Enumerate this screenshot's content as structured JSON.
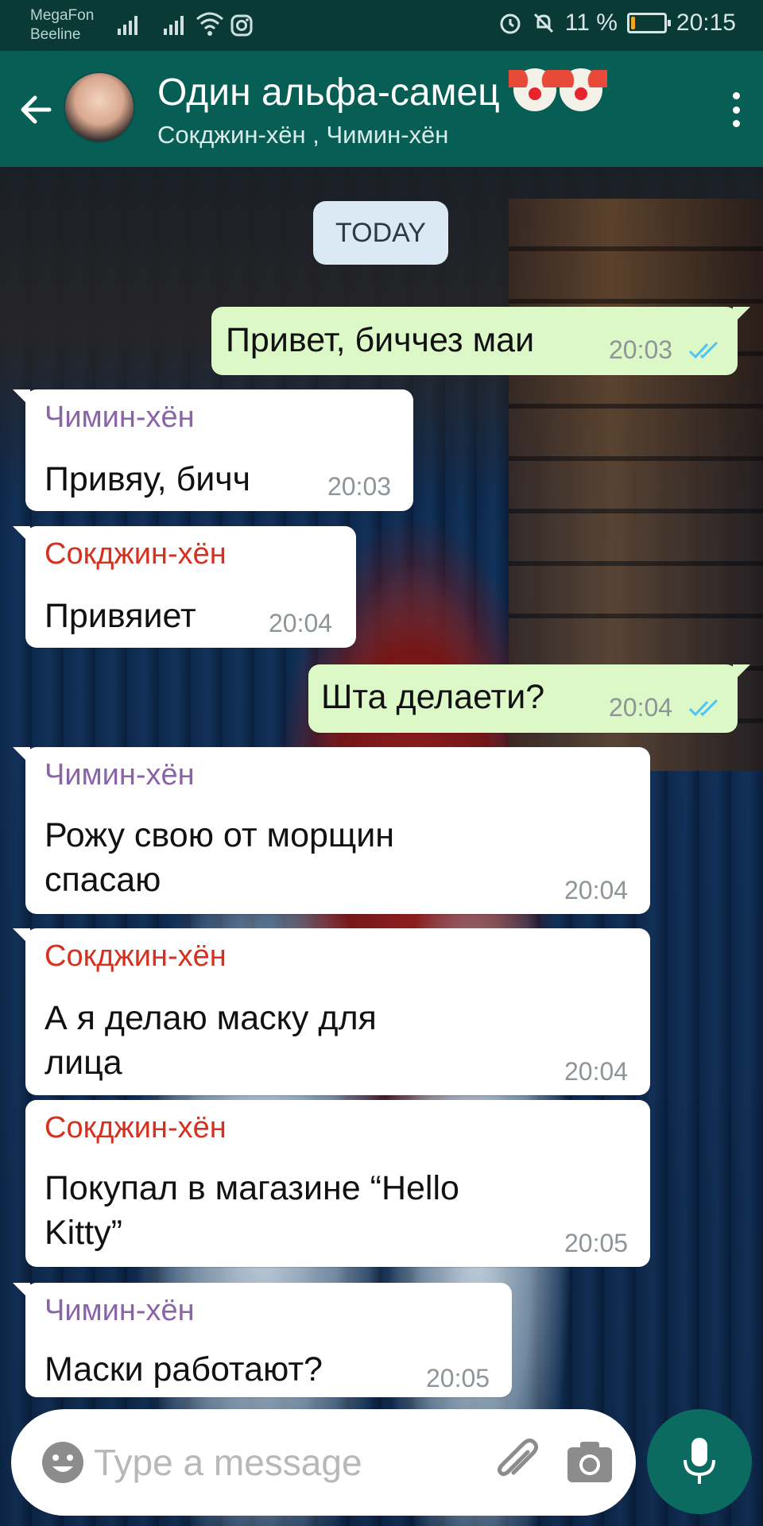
{
  "status_bar": {
    "carrier_1": "MegaFon",
    "carrier_2": "Beeline",
    "battery": "11 %",
    "battery_level": 0.11,
    "time": "20:15",
    "icons": [
      "signal-icon",
      "signal-icon",
      "wifi-icon",
      "instagram-icon",
      "alarm-icon",
      "mute-icon",
      "battery-icon"
    ]
  },
  "header": {
    "title": "Один альфа-самец",
    "title_emoji": [
      "clown-emoji",
      "clown-emoji"
    ],
    "subtitle": "Сокджин-хён , Чимин-хён"
  },
  "chat": {
    "date_chip": "TODAY",
    "messages": [
      {
        "direction": "out",
        "text": "Привет, биччез маи",
        "time": "20:03",
        "status": "read"
      },
      {
        "direction": "in",
        "sender": "Чимин-хён",
        "text": "Привяу, бичч",
        "time": "20:03"
      },
      {
        "direction": "in",
        "sender": "Сокджин-хён",
        "text": "Привяиет",
        "time": "20:04"
      },
      {
        "direction": "out",
        "text": "Шта делаети?",
        "time": "20:04",
        "status": "read"
      },
      {
        "direction": "in",
        "sender": "Чимин-хён",
        "text_lines": [
          "Рожу свою от морщин",
          "спасаю"
        ],
        "time": "20:04"
      },
      {
        "direction": "in",
        "sender": "Сокджин-хён",
        "text_lines": [
          "А я делаю маску для",
          "лица"
        ],
        "time": "20:04"
      },
      {
        "direction": "in",
        "sender": "Сокджин-хён",
        "text_lines": [
          "Покупал в магазине “Hello",
          "Kitty”"
        ],
        "time": "20:05"
      },
      {
        "direction": "in",
        "sender": "Чимин-хён",
        "text": "Маски работают?",
        "time": "20:05"
      }
    ]
  },
  "input": {
    "placeholder": "Type a message",
    "value": ""
  },
  "colors": {
    "header": "#075e54",
    "status_bar": "#0a3a36",
    "outgoing_bubble": "#dcf8c6",
    "incoming_bubble": "#ffffff",
    "sender_purple": "#8a63a8",
    "sender_red": "#d6301f",
    "read_ticks": "#4fc3f7",
    "mic_button": "#0b6b61"
  }
}
